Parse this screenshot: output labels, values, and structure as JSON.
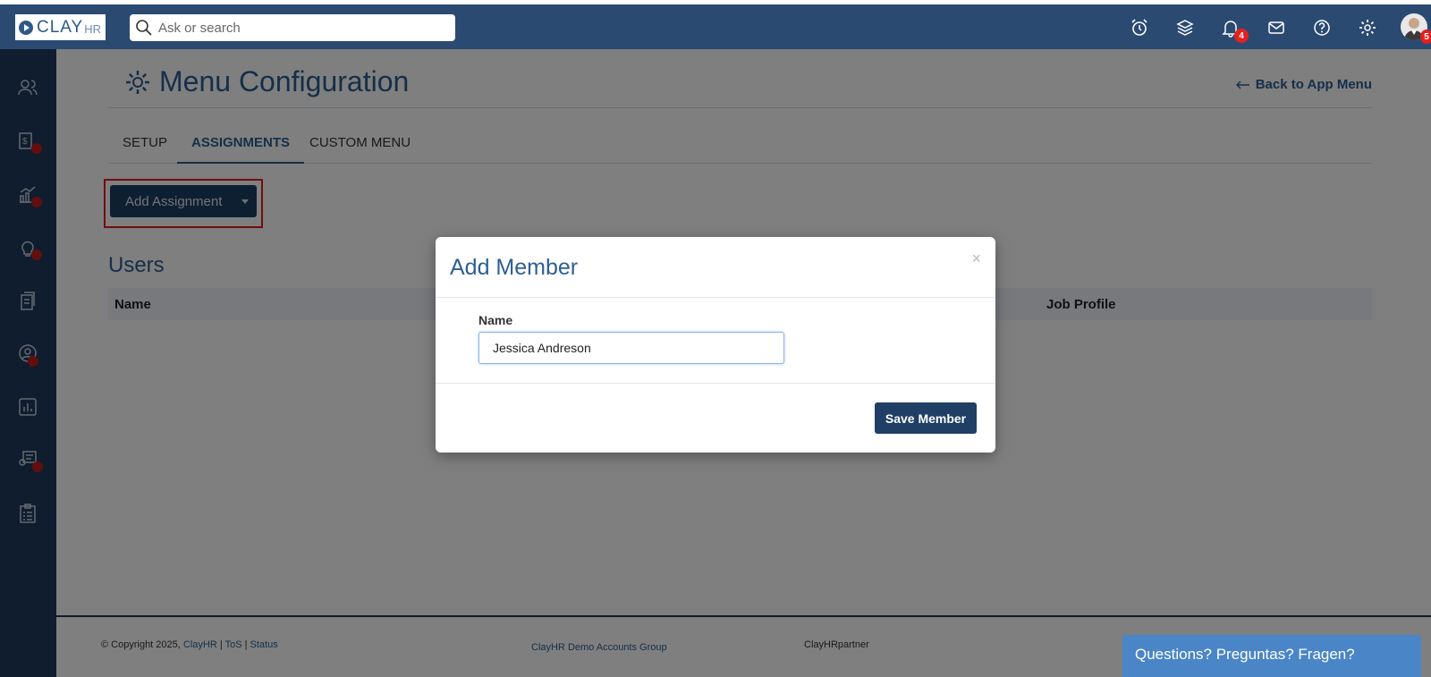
{
  "brand": {
    "logo_main": "CLAY",
    "logo_sub": "HR"
  },
  "search": {
    "placeholder": "Ask or search"
  },
  "topbar": {
    "icons": [
      "alarm-icon",
      "layers-icon",
      "bell-icon",
      "mail-icon",
      "help-icon",
      "gear-icon",
      "avatar"
    ],
    "bell_badge": "4",
    "avatar_badge": "5"
  },
  "sidebar": {
    "items": [
      {
        "icon": "people-icon",
        "alert": false
      },
      {
        "icon": "payroll-icon",
        "alert": true
      },
      {
        "icon": "analytics-icon",
        "alert": true
      },
      {
        "icon": "lightbulb-icon",
        "alert": true
      },
      {
        "icon": "documents-icon",
        "alert": false
      },
      {
        "icon": "profile-icon",
        "alert": true
      },
      {
        "icon": "reports-icon",
        "alert": false
      },
      {
        "icon": "onboarding-icon",
        "alert": true
      },
      {
        "icon": "checklist-icon",
        "alert": false
      }
    ]
  },
  "page": {
    "title": "Menu Configuration",
    "back_link": "Back to App Menu",
    "tabs": [
      "SETUP",
      "ASSIGNMENTS",
      "CUSTOM MENU"
    ],
    "active_tab": "ASSIGNMENTS",
    "add_assignment_label": "Add Assignment",
    "users_title": "Users",
    "table_headers": [
      "Name",
      "Job Profile"
    ]
  },
  "footer": {
    "copyright": "© Copyright 2025,",
    "company_link": "ClayHR",
    "tos": "ToS",
    "status": "Status",
    "sep": "|",
    "group": "ClayHR Demo Accounts Group",
    "partner": "ClayHRpartner",
    "chat": "Questions? Preguntas? Fragen?"
  },
  "modal": {
    "title": "Add Member",
    "close": "×",
    "field_label": "Name",
    "field_value": "Jessica Andreson",
    "save_label": "Save Member"
  },
  "colors": {
    "topbar": "#2a4a72",
    "sidebar": "#1e3a5c",
    "accent": "#2d5f92",
    "button": "#1f3f64",
    "alert": "#c41c1c",
    "highlight": "#e11c1c"
  }
}
